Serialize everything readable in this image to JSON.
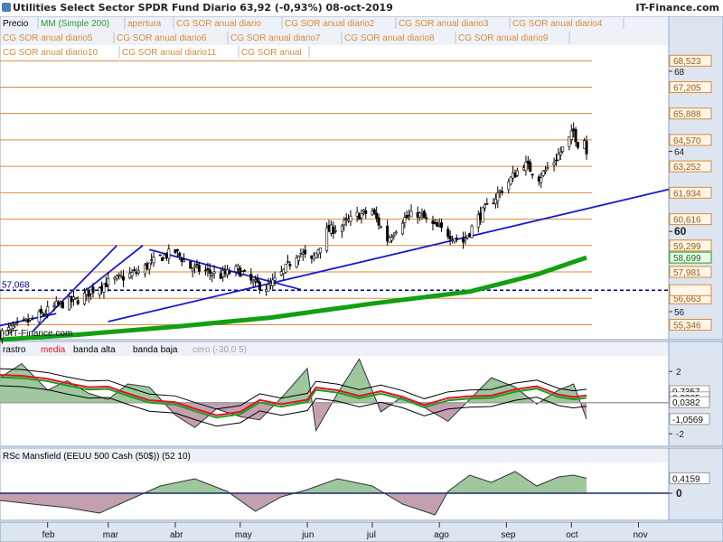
{
  "header": {
    "title": "Utilities Select Sector SPDR Fund   Diario   63,92 (-0,93%)   08-oct-2019",
    "brand": "IT-Finance.com"
  },
  "colors": {
    "bg": "#ffffff",
    "axis_bg": "#dde5f0",
    "legend_bg": "#eef2f8",
    "price_up": "#ffffff",
    "price_down": "#000000",
    "ma200": "#11a011",
    "sor_lines": "#d98a3a",
    "trend_lines": "#1a1acc",
    "support_dotted": "#000080",
    "fill_pos": "#9ec79e",
    "fill_neg": "#c2a0b0",
    "media": "#e0102a",
    "band": "#000000",
    "cero": "#a0a0a0"
  },
  "chart_data": [
    {
      "type": "line",
      "panel": "price",
      "legend": [
        "Precio",
        "MM (Simple 200)",
        "apertura",
        "CG SOR anual diario",
        "CG SOR anual diario2",
        "CG SOR anual diario3",
        "CG SOR anual diario4",
        "CG SOR anual diario5",
        "CG SOR anual diario6",
        "CG SOR anual diario7",
        "CG SOR anual diario8",
        "CG SOR anual diario9",
        "CG SOR anual diario10",
        "CG SOR anual diario11",
        "CG SOR anual"
      ],
      "ylim": [
        54.6,
        69.3
      ],
      "y_ticks": [
        68,
        64,
        60,
        56
      ],
      "level_labels": [
        "68,523",
        "67,205",
        "65,888",
        "64,570",
        "63,252",
        "61,934",
        "60,616",
        "59,299",
        "58,699",
        "57,981",
        "56,663",
        "55,346"
      ],
      "sor_levels": [
        68.523,
        67.205,
        65.888,
        64.57,
        63.252,
        61.934,
        60.616,
        59.299,
        57.981,
        56.663,
        55.346
      ],
      "ma200_value": "58,699",
      "support_label": "57,068",
      "support_value": 57.068,
      "x_labels": [
        "feb",
        "mar",
        "abr",
        "may",
        "jun",
        "jul",
        "ago",
        "sep",
        "oct",
        "nov"
      ],
      "x_dates": [
        "2019-02-01",
        "2019-03-01",
        "2019-04-01",
        "2019-05-01",
        "2019-06-01",
        "2019-07-01",
        "2019-08-01",
        "2019-09-01",
        "2019-10-01",
        "2019-11-01"
      ],
      "date_range": [
        "2019-01-10",
        "2019-11-15"
      ],
      "close_path": [
        [
          "2019-01-10",
          54.9
        ],
        [
          "2019-01-25",
          55.6
        ],
        [
          "2019-02-05",
          56.3
        ],
        [
          "2019-02-15",
          56.6
        ],
        [
          "2019-02-25",
          57.3
        ],
        [
          "2019-03-05",
          57.6
        ],
        [
          "2019-03-15",
          58.0
        ],
        [
          "2019-03-25",
          58.7
        ],
        [
          "2019-04-01",
          59.0
        ],
        [
          "2019-04-08",
          58.2
        ],
        [
          "2019-04-15",
          58.0
        ],
        [
          "2019-04-22",
          57.8
        ],
        [
          "2019-04-30",
          58.1
        ],
        [
          "2019-05-07",
          57.4
        ],
        [
          "2019-05-14",
          57.2
        ],
        [
          "2019-05-21",
          58.0
        ],
        [
          "2019-05-28",
          59.0
        ],
        [
          "2019-06-03",
          58.5
        ],
        [
          "2019-06-10",
          60.0
        ],
        [
          "2019-06-17",
          60.3
        ],
        [
          "2019-06-24",
          60.8
        ],
        [
          "2019-07-01",
          61.0
        ],
        [
          "2019-07-08",
          59.6
        ],
        [
          "2019-07-15",
          60.6
        ],
        [
          "2019-07-22",
          60.9
        ],
        [
          "2019-07-29",
          60.3
        ],
        [
          "2019-08-05",
          59.9
        ],
        [
          "2019-08-12",
          59.5
        ],
        [
          "2019-08-19",
          60.7
        ],
        [
          "2019-08-26",
          61.6
        ],
        [
          "2019-09-02",
          62.5
        ],
        [
          "2019-09-09",
          63.4
        ],
        [
          "2019-09-16",
          62.7
        ],
        [
          "2019-09-23",
          63.5
        ],
        [
          "2019-09-30",
          64.6
        ],
        [
          "2019-10-02",
          65.0
        ],
        [
          "2019-10-04",
          64.4
        ],
        [
          "2019-10-07",
          64.6
        ],
        [
          "2019-10-08",
          63.92
        ]
      ],
      "ma200_path": [
        [
          "2019-01-10",
          54.6
        ],
        [
          "2019-02-15",
          54.85
        ],
        [
          "2019-04-01",
          55.25
        ],
        [
          "2019-05-15",
          55.7
        ],
        [
          "2019-07-01",
          56.4
        ],
        [
          "2019-08-15",
          57.0
        ],
        [
          "2019-09-15",
          57.85
        ],
        [
          "2019-10-08",
          58.7
        ]
      ],
      "trendlines": [
        {
          "from": [
            "2019-01-10",
            55.3
          ],
          "to": [
            "2019-02-05",
            55.9
          ]
        },
        {
          "from": [
            "2019-01-25",
            55.0
          ],
          "to": [
            "2019-03-05",
            59.3
          ]
        },
        {
          "from": [
            "2019-02-18",
            57.0
          ],
          "to": [
            "2019-03-17",
            59.3
          ]
        },
        {
          "from": [
            "2019-03-20",
            59.1
          ],
          "to": [
            "2019-05-29",
            57.1
          ]
        },
        {
          "from": [
            "2019-03-01",
            55.5
          ],
          "to": [
            "2019-11-15",
            62.1
          ]
        }
      ]
    },
    {
      "type": "area",
      "panel": "rastro",
      "legend": [
        "rastro",
        "media",
        "banda alta",
        "banda baja",
        "cero (-30,0 5)"
      ],
      "ylim": [
        -2.8,
        3.0
      ],
      "y_ticks": [
        2,
        -2
      ],
      "value_labels": [
        "0,7357",
        "0,3395",
        "0,0382",
        "-1,0569"
      ],
      "path": [
        [
          "2019-01-10",
          1.6
        ],
        [
          "2019-01-20",
          2.5
        ],
        [
          "2019-02-01",
          0.8
        ],
        [
          "2019-02-10",
          1.4
        ],
        [
          "2019-02-20",
          0.6
        ],
        [
          "2019-03-01",
          0.2
        ],
        [
          "2019-03-10",
          1.2
        ],
        [
          "2019-03-20",
          1.0
        ],
        [
          "2019-04-01",
          -0.8
        ],
        [
          "2019-04-10",
          -1.6
        ],
        [
          "2019-04-20",
          -0.4
        ],
        [
          "2019-05-01",
          -0.9
        ],
        [
          "2019-05-10",
          -1.1
        ],
        [
          "2019-05-20",
          0.3
        ],
        [
          "2019-06-01",
          2.2
        ],
        [
          "2019-06-05",
          -1.8
        ],
        [
          "2019-06-15",
          0.6
        ],
        [
          "2019-06-25",
          2.8
        ],
        [
          "2019-07-05",
          -0.6
        ],
        [
          "2019-07-15",
          0.4
        ],
        [
          "2019-07-25",
          -0.3
        ],
        [
          "2019-08-05",
          -1.2
        ],
        [
          "2019-08-15",
          0.2
        ],
        [
          "2019-08-25",
          1.6
        ],
        [
          "2019-09-05",
          1.0
        ],
        [
          "2019-09-15",
          -0.1
        ],
        [
          "2019-09-25",
          0.8
        ],
        [
          "2019-10-02",
          1.2
        ],
        [
          "2019-10-08",
          -1.06
        ]
      ]
    },
    {
      "type": "area",
      "panel": "rsc",
      "legend": [
        "RSc Mansfield (EEUU 500 Cash (50$)) (52 10)"
      ],
      "ylim": [
        -0.75,
        0.85
      ],
      "y_ticks": [
        0
      ],
      "value_labels": [
        "0,4159"
      ],
      "path": [
        [
          "2019-01-10",
          -0.2
        ],
        [
          "2019-01-25",
          -0.3
        ],
        [
          "2019-02-10",
          -0.4
        ],
        [
          "2019-02-25",
          -0.55
        ],
        [
          "2019-03-10",
          -0.2
        ],
        [
          "2019-03-25",
          0.2
        ],
        [
          "2019-04-10",
          0.4
        ],
        [
          "2019-04-25",
          0.05
        ],
        [
          "2019-05-08",
          -0.5
        ],
        [
          "2019-05-20",
          -0.1
        ],
        [
          "2019-06-01",
          0.1
        ],
        [
          "2019-06-15",
          0.4
        ],
        [
          "2019-07-01",
          0.2
        ],
        [
          "2019-07-15",
          -0.3
        ],
        [
          "2019-07-30",
          -0.6
        ],
        [
          "2019-08-05",
          0.05
        ],
        [
          "2019-08-15",
          0.5
        ],
        [
          "2019-08-25",
          0.3
        ],
        [
          "2019-09-05",
          0.6
        ],
        [
          "2019-09-15",
          0.2
        ],
        [
          "2019-09-25",
          0.45
        ],
        [
          "2019-10-02",
          0.5
        ],
        [
          "2019-10-08",
          0.4159
        ]
      ]
    }
  ]
}
